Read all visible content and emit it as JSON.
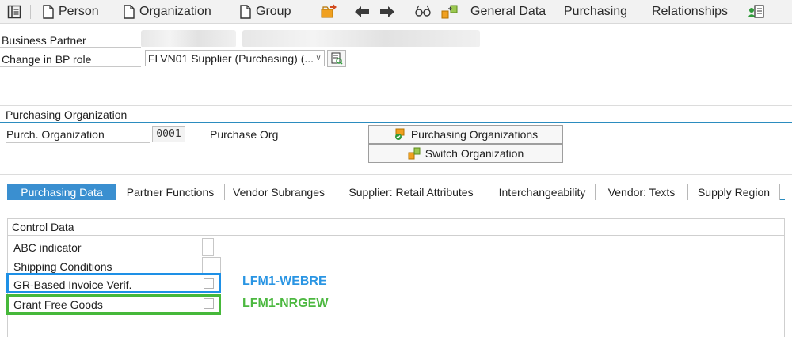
{
  "toolbar": {
    "person_label": "Person",
    "organization_label": "Organization",
    "group_label": "Group",
    "general_data_label": "General Data",
    "purchasing_label": "Purchasing",
    "relationships_label": "Relationships"
  },
  "header": {
    "business_partner_label": "Business Partner",
    "change_in_bp_role_label": "Change in BP role",
    "bp_role_value": "FLVN01 Supplier (Purchasing) (..."
  },
  "purch_org": {
    "section_title": "Purchasing Organization",
    "field_label": "Purch. Organization",
    "code": "0001",
    "description": "Purchase Org",
    "purchasing_orgs_button": "Purchasing Organizations",
    "switch_org_button": "Switch Organization"
  },
  "tabs": [
    {
      "label": "Purchasing Data",
      "active": true
    },
    {
      "label": "Partner Functions",
      "active": false
    },
    {
      "label": "Vendor Subranges",
      "active": false
    },
    {
      "label": "Supplier: Retail Attributes",
      "active": false
    },
    {
      "label": "Interchangeability",
      "active": false
    },
    {
      "label": "Vendor: Texts",
      "active": false
    },
    {
      "label": "Supply Region",
      "active": false
    }
  ],
  "control_data": {
    "title": "Control Data",
    "abc_indicator": "ABC indicator",
    "shipping_conditions": "Shipping Conditions",
    "gr_based_invoice": "GR-Based Invoice Verif.",
    "grant_free_goods": "Grant Free Goods"
  },
  "annotations": {
    "webre": "LFM1-WEBRE",
    "nrgew": "LFM1-NRGEW"
  },
  "colors": {
    "active_tab": "#3a8fd0",
    "blue_highlight": "#1e90e6",
    "green_highlight": "#46b83a",
    "section_line": "#2b8cbf"
  }
}
